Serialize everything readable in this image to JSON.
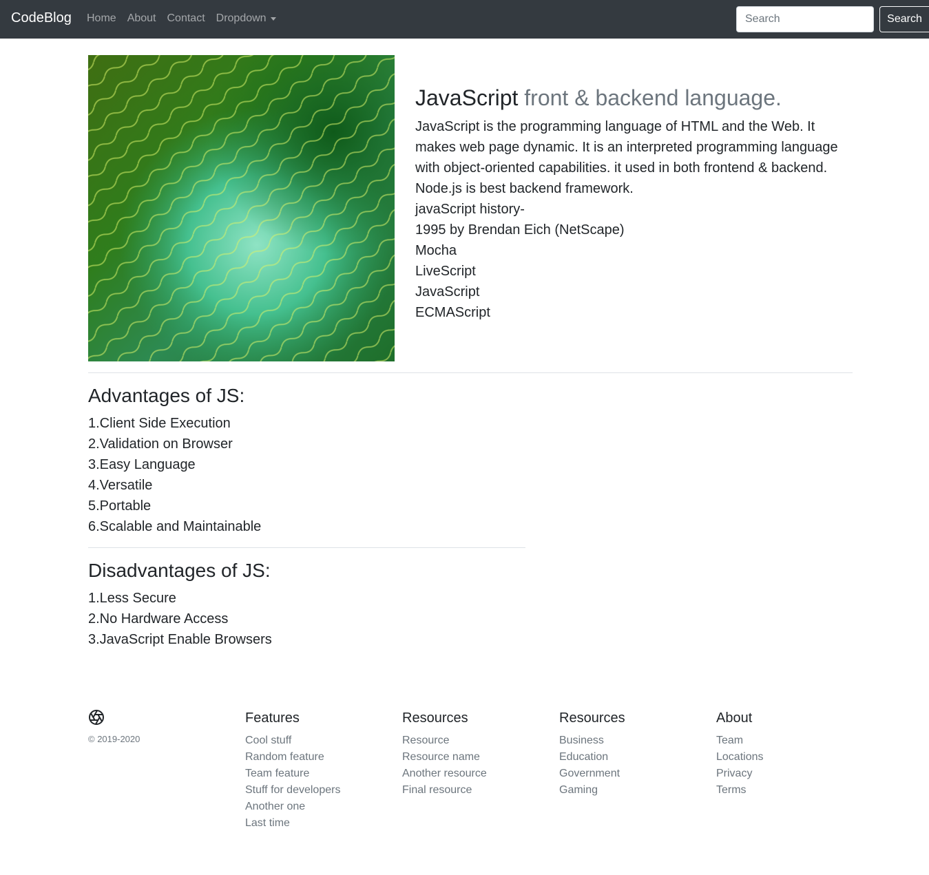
{
  "navbar": {
    "brand": "CodeBlog",
    "links": [
      "Home",
      "About",
      "Contact"
    ],
    "dropdown": "Dropdown",
    "search_placeholder": "Search",
    "search_button": "Search"
  },
  "hero": {
    "title_main": "JavaScript",
    "title_muted": "front & backend language.",
    "lead": "JavaScript is the programming language of HTML and the Web. It makes web page dynamic. It is an interpreted programming language with object-oriented capabilities. it used in both frontend & backend. Node.js is best backend framework.",
    "history_heading": "javaScript history-",
    "history": [
      "1995 by Brendan Eich (NetScape)",
      "Mocha",
      "LiveScript",
      "JavaScript",
      "ECMAScript"
    ]
  },
  "advantages": {
    "title": "Advantages of JS:",
    "items": [
      "1.Client Side Execution",
      "2.Validation on Browser",
      "3.Easy Language",
      "4.Versatile",
      "5.Portable",
      "6.Scalable and Maintainable"
    ]
  },
  "disadvantages": {
    "title": "Disadvantages of JS:",
    "items": [
      "1.Less Secure",
      "2.No Hardware Access",
      "3.JavaScript Enable Browsers"
    ]
  },
  "footer": {
    "logo_icon": "aperture-icon",
    "copyright": "© 2019-2020",
    "columns": [
      {
        "title": "Features",
        "links": [
          "Cool stuff",
          "Random feature",
          "Team feature",
          "Stuff for developers",
          "Another one",
          "Last time"
        ]
      },
      {
        "title": "Resources",
        "links": [
          "Resource",
          "Resource name",
          "Another resource",
          "Final resource"
        ]
      },
      {
        "title": "Resources",
        "links": [
          "Business",
          "Education",
          "Government",
          "Gaming"
        ]
      },
      {
        "title": "About",
        "links": [
          "Team",
          "Locations",
          "Privacy",
          "Terms"
        ]
      }
    ]
  }
}
